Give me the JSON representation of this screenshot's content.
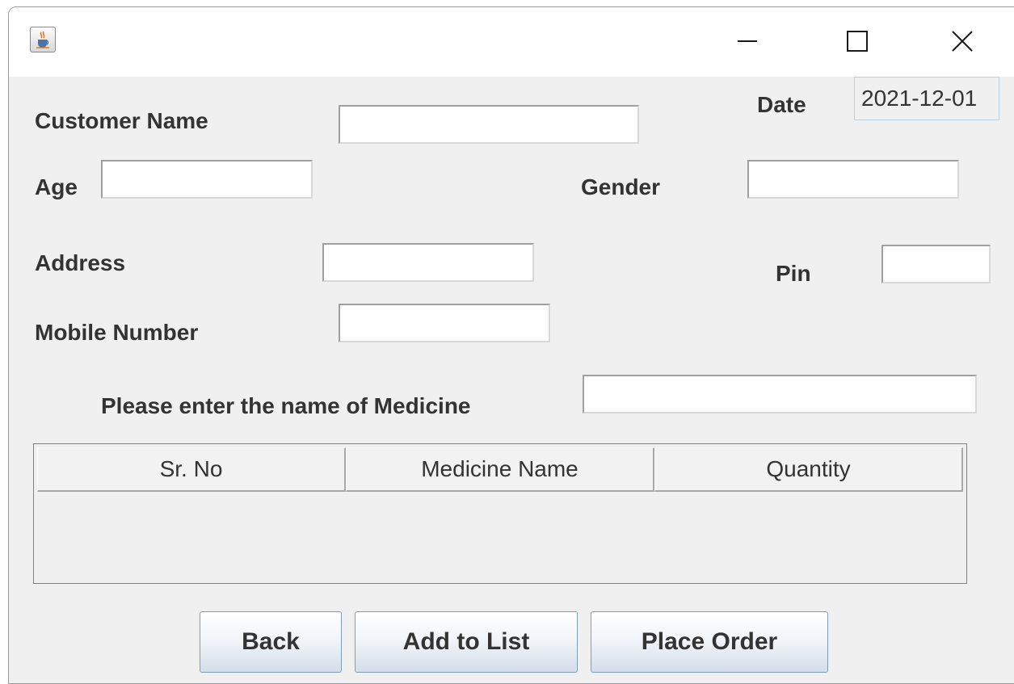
{
  "window": {
    "icon": "java-cup-icon",
    "controls": [
      "minimize-icon",
      "maximize-icon",
      "close-icon"
    ]
  },
  "form": {
    "customer_name_label": "Customer Name",
    "customer_name_value": "",
    "date_label": "Date",
    "date_value": "2021-12-01",
    "age_label": "Age",
    "age_value": "",
    "gender_label": "Gender",
    "gender_value": "",
    "address_label": "Address",
    "address_value": "",
    "pin_label": "Pin",
    "pin_value": "",
    "mobile_label": "Mobile Number",
    "mobile_value": "",
    "medicine_label": "Please enter the name of Medicine",
    "medicine_value": ""
  },
  "table": {
    "columns": [
      "Sr. No",
      "Medicine Name",
      "Quantity"
    ],
    "rows": []
  },
  "buttons": {
    "back": "Back",
    "add": "Add to List",
    "order": "Place Order"
  },
  "colors": {
    "panel": "#f0f0f0",
    "titlebar": "#ffffff",
    "text": "#333333",
    "button_gradient_end": "#d4deea"
  }
}
